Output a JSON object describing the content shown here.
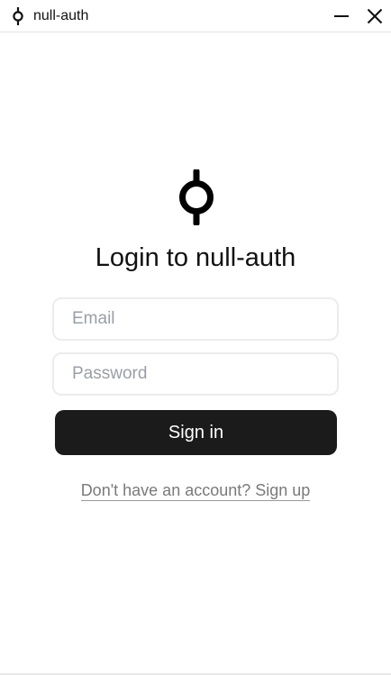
{
  "window": {
    "title": "null-auth",
    "app_icon": "null-auth-logo-icon",
    "minimize_icon": "minimize-icon",
    "close_icon": "close-icon"
  },
  "login": {
    "logo_icon": "null-auth-logo-icon",
    "heading": "Login to null-auth",
    "email": {
      "placeholder": "Email",
      "value": ""
    },
    "password": {
      "placeholder": "Password",
      "value": ""
    },
    "signin_label": "Sign in",
    "signup_link": "Don't have an account? Sign up"
  },
  "colors": {
    "button_bg": "#1b1b1b",
    "button_text": "#ffffff",
    "link_text": "#7a7a7a",
    "input_border": "#ececec"
  }
}
